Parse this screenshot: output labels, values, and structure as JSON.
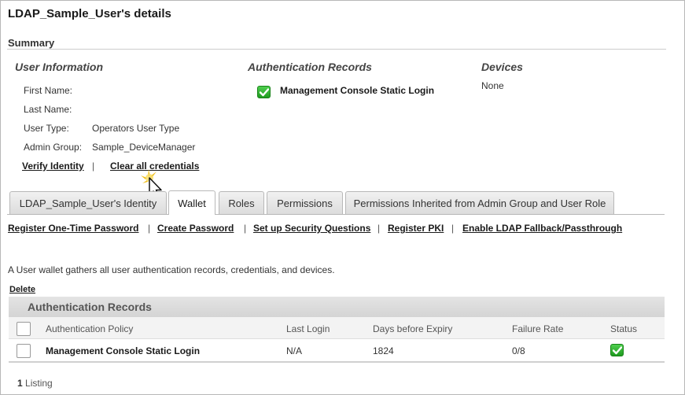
{
  "page": {
    "title": "LDAP_Sample_User's details"
  },
  "summary": {
    "title": "Summary",
    "user_info": {
      "heading": "User Information",
      "fields": [
        {
          "label": "First Name:",
          "value": ""
        },
        {
          "label": "Last Name:",
          "value": ""
        },
        {
          "label": "User Type:",
          "value": "Operators User Type"
        },
        {
          "label": "Admin Group:",
          "value": "Sample_DeviceManager"
        }
      ],
      "verify_link": "Verify Identity",
      "separator": "|",
      "clear_link": "Clear all credentials"
    },
    "auth_records": {
      "heading": "Authentication Records",
      "items": [
        {
          "label": "Management Console Static Login",
          "icon": "green-check-icon"
        }
      ]
    },
    "devices": {
      "heading": "Devices",
      "value": "None"
    }
  },
  "tabs": [
    {
      "label": "LDAP_Sample_User's Identity",
      "active": false
    },
    {
      "label": "Wallet",
      "active": true
    },
    {
      "label": "Roles",
      "active": false
    },
    {
      "label": "Permissions",
      "active": false
    },
    {
      "label": "Permissions Inherited from Admin Group and User Role",
      "active": false
    }
  ],
  "wallet": {
    "actions": [
      "Register One-Time Password",
      "Create Password",
      "Set up Security Questions",
      "Register PKI",
      "Enable LDAP Fallback/Passthrough"
    ],
    "separator": "|",
    "description": "A User wallet gathers all user authentication records, credentials, and devices.",
    "delete_label": "Delete",
    "grid": {
      "title": "Authentication Records",
      "columns": [
        "Authentication Policy",
        "Last Login",
        "Days before Expiry",
        "Failure Rate",
        "Status"
      ],
      "rows": [
        {
          "policy": "Management Console Static Login",
          "last_login": "N/A",
          "days_before_expiry": "1824",
          "failure_rate": "0/8",
          "status_icon": "green-check-icon"
        }
      ]
    },
    "listing_count": "1",
    "listing_label": "Listing"
  },
  "colors": {
    "status_ok": "#2aa52a",
    "grid_header_bg": "#d9d9d9",
    "border": "#b8b8b8"
  }
}
